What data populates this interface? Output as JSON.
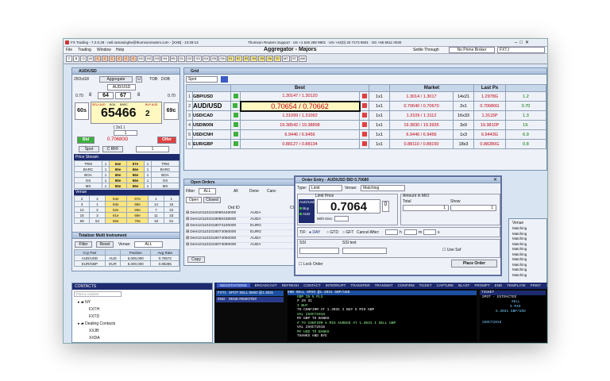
{
  "app": {
    "title": "FX Trading - 7.2.0.28 - neil.ramasinghe@thomsonreuters.com - [XXB] - 13:29:13",
    "support": "Thomson Reuters Support · US +1 646 288 9901 · UN +44(0) 20 7173 9601 · SG +65 6511 0030"
  },
  "menu": [
    "File",
    "Trading",
    "Window",
    "Help"
  ],
  "header": {
    "aggregator": "Aggregator - Majors",
    "settle_label": "Settle Through",
    "settle_value": "No Prime Broker",
    "pair": "FXTJ"
  },
  "toolbar": [
    "T",
    "B",
    "O",
    "M",
    "C",
    "C",
    "C",
    "C",
    "C",
    "C",
    "H1",
    "H2",
    "H3",
    "H4",
    "H5",
    "G1",
    "G2",
    "G3",
    "G4",
    "G5",
    "G6",
    "S1",
    "S2",
    "S3",
    "S4",
    "S5",
    "S6",
    "S7",
    "MT",
    "ST",
    "AM"
  ],
  "deal_ticket": {
    "title": "AUD/USD",
    "date": "25Oct18",
    "aggregate": "Aggregate",
    "u": "U",
    "tob": "TOB",
    "dob": "DOB",
    "pair": "AUD/USD",
    "bid_small": "0.70",
    "ask_small": "0.70",
    "bid_mid": "64",
    "ask_mid": "67",
    "bid_end": "8",
    "ask_end": "8",
    "sell_label": "SELL AUD",
    "buy_label": "BUY AUD",
    "boa": "BOA",
    "barc": "BARC",
    "big": "65466",
    "big_suffix": "2",
    "left_tenor": "60s",
    "right_tenor": "69c",
    "spread": "( 2x1 )",
    "size": "1",
    "bid_btn": "Bid",
    "bid_price": "0.70680G",
    "offer_btn": "Offer",
    "spot": "Spot",
    "tabs": "C RFF",
    "qty": "1"
  },
  "price_stream": {
    "title": "Price Stream",
    "rows": [
      [
        "TRM",
        "1",
        "64e",
        "67e",
        "1",
        "TRM"
      ],
      [
        "BARC",
        "1",
        "65e",
        "66e",
        "1",
        "BARC"
      ],
      [
        "BOA",
        "1",
        "65e",
        "66e",
        "1",
        "BOA"
      ],
      [
        "GS",
        "1",
        "65e",
        "66e",
        "1",
        "GS"
      ],
      [
        "MS",
        "1",
        "65e",
        "66e",
        "1",
        "MS"
      ]
    ]
  },
  "venue": {
    "title": "Venue",
    "rows": [
      [
        "2",
        "2",
        "64e",
        "67e",
        "1",
        "1"
      ],
      [
        "3",
        "1",
        "63e",
        "68e",
        "14",
        "15"
      ],
      [
        "12",
        "2",
        "62e",
        "69e",
        "7",
        "22"
      ],
      [
        "15",
        "3",
        "61e",
        "69e",
        "11",
        "33"
      ],
      [
        "69",
        "54",
        "60e",
        "70e",
        "18",
        "51"
      ]
    ]
  },
  "totalizer": {
    "title": "Totalizer Multi Instrument",
    "filter": "Filter",
    "reset": "Reset",
    "venue_label": "Venue:",
    "venue_val": "ALL",
    "cols": [
      "Ccy Pair",
      "",
      "Position",
      "Avg Rate"
    ],
    "rows": [
      [
        "AUD/USD",
        "AUD",
        "5,000,000",
        "0.70672"
      ],
      [
        "EUR/GBP",
        "EUR",
        "5,000,000",
        "0.88285"
      ]
    ]
  },
  "grid": {
    "title": "Grid",
    "tenor": "Spot",
    "best": "Best",
    "market": "Market",
    "last": "Last Px",
    "rows": [
      {
        "pair": "GBP/USD",
        "bid": "1.30147",
        "ask": "1.30120",
        "size": "1x1",
        "m": "1.3014 / 1.3017",
        "ms": "14x21",
        "last": "1.2978G",
        "e": "1.2"
      },
      {
        "pair": "AUD/USD",
        "bid": "0.70654",
        "ask": "0.70662",
        "size": "1x1",
        "m": "0.70640 / 0.70670",
        "ms": "2x1",
        "last": "0.70680G",
        "e": "0.70"
      },
      {
        "pair": "USD/CAD",
        "bid": "1.31099",
        "ask": "1.31092",
        "size": "1x1",
        "m": "1.3109 / 1.3112",
        "ms": "16x33",
        "last": "1.3115P",
        "e": "1.3"
      },
      {
        "pair": "USD/MXN",
        "bid": "19.38542",
        "ask": "19.38898",
        "size": "1x1",
        "m": "19.3830 / 19.3935",
        "ms": "3x9",
        "last": "19.3810P",
        "e": "19."
      },
      {
        "pair": "USD/CNH",
        "bid": "6.9446",
        "ask": "6.9456",
        "size": "1x1",
        "m": "6.9446 / 6.9456",
        "ms": "1x3",
        "last": "6.9443G",
        "e": "6.9"
      },
      {
        "pair": "EUR/GBP",
        "bid": "0.88127",
        "ask": "0.88134",
        "size": "1x1",
        "m": "0.88110 / 0.88150",
        "ms": "18x3",
        "last": "0.88280G",
        "e": "0.8"
      }
    ]
  },
  "orders": {
    "title": "Open Orders",
    "filter": "Filter",
    "all": "ALL",
    "f_all": "All",
    "f_done": "Done",
    "f_canc": "Canc",
    "tabs": [
      "Open",
      "Closed"
    ],
    "col_id": "Ord ID",
    "col_ccy": "CCY",
    "rows": [
      [
        "Dem101102318080446000",
        "AUDA"
      ],
      [
        "Dem101102318080438000",
        "AUDA"
      ],
      [
        "Dem101102318074100000",
        "EURG"
      ],
      [
        "Dem101102318074050000",
        "EURG"
      ],
      [
        "Dem101102318074050000",
        "AUDA"
      ],
      [
        "Dem101102318074060000",
        "AUDA"
      ]
    ],
    "copy": "Copy"
  },
  "order_entry": {
    "title": "Order Entry - AUD/USD  BID 0.70680",
    "type_label": "Type:",
    "type": "Limit",
    "venue_label": "Venue:",
    "venue": "Matching",
    "limit_price": "Limit Price",
    "pair": "AUD/USD",
    "buy": "Buy",
    "aud": "AUD",
    "price": "0.7064",
    "price_suffix": "0",
    "with_disc": "With Disc:",
    "amount": "Amount in MIO",
    "total": "Total",
    "show": "Show",
    "total_v": "1",
    "show_v": "1",
    "tif": "TIF:",
    "day": "DAY",
    "gtd": "GTD",
    "gft": "GFT",
    "cancel_after": "Cancel After:",
    "h": "h",
    "m": "m",
    "s": "s",
    "ssi": "SSI",
    "ssi_text": "SSI text",
    "use_ssf": "Use Ssf",
    "lock": "Lock Order",
    "place": "Place Order"
  },
  "right_venue": {
    "title": "Venue",
    "rows": [
      "Matching",
      "Matching",
      "Matching",
      "Matching",
      "Matching",
      "Matching",
      "Matching",
      "Matching",
      "Matching",
      "Matching"
    ]
  },
  "contacts": {
    "title": "CONTACTS",
    "find": "Find a contact",
    "tree": [
      "NY",
      "FXTH",
      "FXTD",
      "Dealing Contacts",
      "XXJB",
      "XXDA"
    ]
  },
  "neg": {
    "tabs": [
      "NEGOTIATIONS",
      "BROADCAST",
      "REFRESH",
      "CONTACT",
      "INTERRUPT",
      "TRANSFER",
      "TRANSMIT",
      "CONFIRM",
      "TICKET",
      "CAPTURE",
      "BLAST",
      "PROMPT",
      "END",
      "TEMPLATE",
      "PRINT"
    ],
    "setup": "Setup",
    "items": [
      {
        "a": "FXT1",
        "b": "SPOT SELL 5MIO @1.3031"
      },
      {
        "a": "END",
        "b": "#END REMOTE#"
      }
    ]
  },
  "chat": {
    "head": "END   SELL       5MIO @1.3031  GBP/USD",
    "lines": [
      "GBP IN 5 PLS",
      "# 29 31",
      "  I BUY",
      "TO CONFIRM AT 1.3031 I BUY 5  MIO GBP",
      "VAL 25OCT2018",
      "MY GBP TO BANKS",
      "# TO CONFIRM 5   MIO AGREED AT 1.3031 I SELL GBP",
      "VAL 25OCT2018",
      "MY USD TO BANKS",
      "THANKS AND BYE"
    ]
  },
  "ticket": {
    "title": "TICKET",
    "l1": "SPOT  -  EXTRACTED",
    "l2": "SELL",
    "l3": "5 MIO",
    "l4": "5.3031 GBP/USD",
    "l5": "25OCT2018"
  }
}
